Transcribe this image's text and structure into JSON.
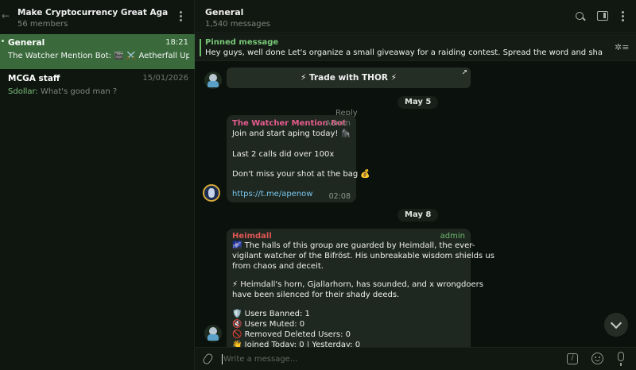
{
  "sidebar": {
    "group_title": "Make Cryptocurrency Great Again💥 ($M...",
    "members": "56 members",
    "chats": [
      {
        "name": "General",
        "time": "18:21",
        "preview": "The Watcher Mention Bot: 🎬 ⚔️ Aetherfall Updat..."
      },
      {
        "name": "MCGA staff",
        "time": "15/01/2026",
        "sender": "Sdollar:",
        "preview": " What's good man ?"
      }
    ]
  },
  "header": {
    "title": "General",
    "subtitle": "1,540 messages"
  },
  "pinned": {
    "label": "Pinned message",
    "text": "Hey guys, well done Let's organize a small giveaway for a raiding contest. Spread the word and share your link for ..."
  },
  "messages": {
    "thor_button": "⚡ Trade with THOR ⚡",
    "date1": "May 5",
    "reply_label": "Reply",
    "watcher": {
      "sender": "The Watcher Mention Bot",
      "role": "Admin",
      "lines": [
        "Join and start aping today! 🦍",
        "Last 2 calls did over 100x",
        "Don't miss your shot at the bag 💰"
      ],
      "link": "https://t.me/apenow",
      "time": "02:08"
    },
    "date2": "May 8",
    "heimdall": {
      "sender": "Heimdall",
      "role": "admin",
      "lines": [
        "🌌 The halls of this group are guarded by Heimdall, the ever-",
        "vigilant watcher of the Bifröst. His unbreakable wisdom shields us",
        "from chaos and deceit.",
        "⚡ Heimdall's horn, Gjallarhorn, has sounded, and x wrongdoers",
        "have been silenced for their shady deeds.",
        "🛡️ Users Banned: 1",
        "🔇 Users Muted: 0",
        "🚫 Removed Deleted Users: 0",
        "👋 Joined Today: 0 | Yesterday: 0"
      ]
    }
  },
  "composer": {
    "placeholder": "Write a message..."
  }
}
